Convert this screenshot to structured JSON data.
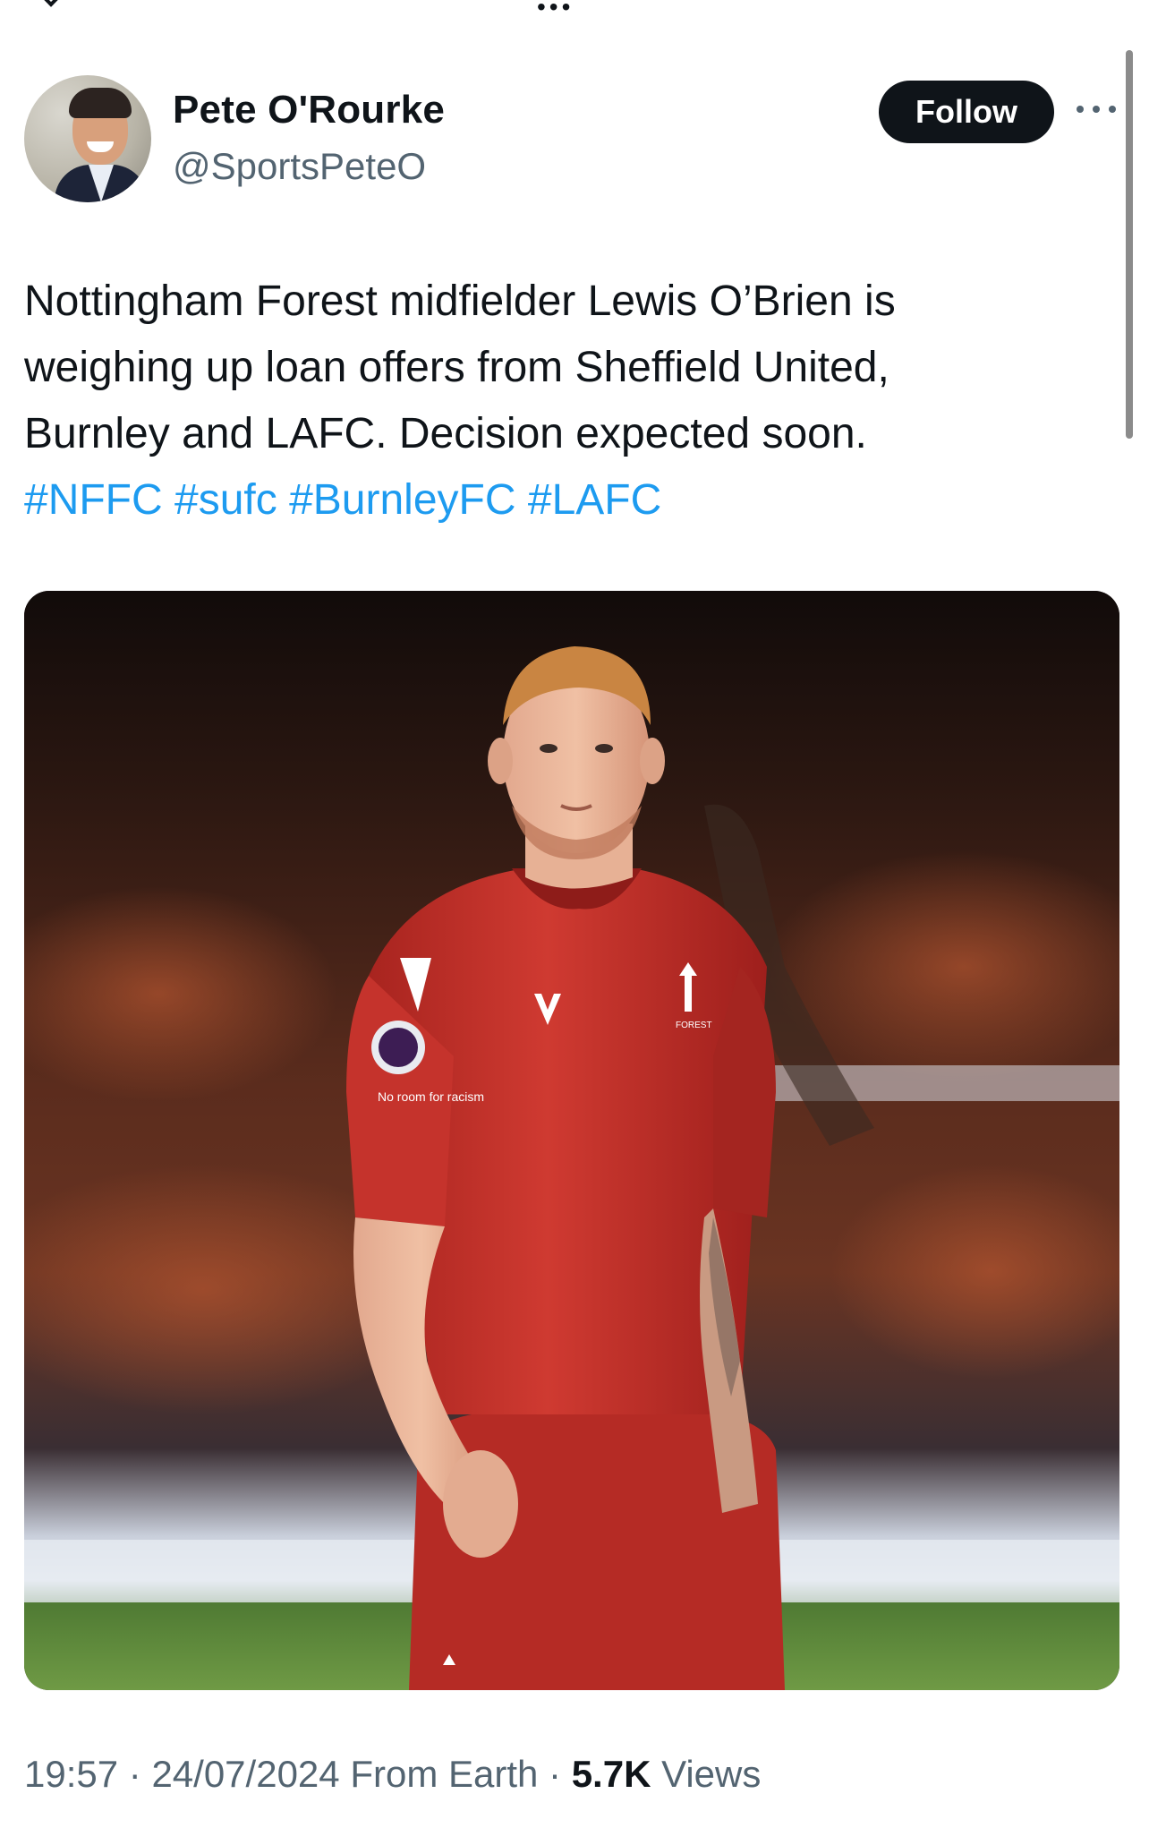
{
  "author": {
    "display_name": "Pete O'Rourke",
    "handle": "@SportsPeteO",
    "follow_label": "Follow"
  },
  "tweet": {
    "lines": [
      "Nottingham Forest midfielder Lewis O’Brien is",
      "weighing up loan offers from Sheffield United,",
      "Burnley and LAFC. Decision expected soon."
    ],
    "hashtags": [
      "#NFFC",
      "#sufc",
      "#BurnleyFC",
      "#LAFC"
    ]
  },
  "media": {
    "sleeve_patch_text": "No room for racism",
    "crest_text": "FOREST",
    "colors": {
      "kit_red": "#c8312b",
      "kit_shadow": "#9e1f1c",
      "pitch_green": "#5d8a3a"
    }
  },
  "meta": {
    "time": "19:57",
    "separator": " · ",
    "date": "24/07/2024",
    "source": "From Earth",
    "views_count": "5.7K",
    "views_label": "Views"
  },
  "icons": {
    "more": "more-horizontal-icon",
    "back": "chevron-left-icon"
  },
  "colors": {
    "text_primary": "#0f1419",
    "text_secondary": "#536471",
    "link": "#1d9bf0",
    "follow_bg": "#0f1419"
  }
}
